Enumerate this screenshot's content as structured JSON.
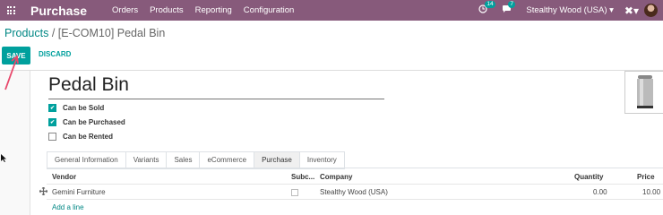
{
  "navbar": {
    "app_name": "Purchase",
    "menu": [
      "Orders",
      "Products",
      "Reporting",
      "Configuration"
    ],
    "activity_count": "14",
    "message_count": "7",
    "company": "Stealthy Wood (USA)",
    "bg_color": "#875a7b"
  },
  "breadcrumb": {
    "parent": "Products",
    "current": "[E-COM10] Pedal Bin"
  },
  "actions": {
    "save": "SAVE",
    "discard": "DISCARD"
  },
  "product": {
    "name": "Pedal Bin",
    "can_be_sold": {
      "label": "Can be Sold",
      "checked": true
    },
    "can_be_purchased": {
      "label": "Can be Purchased",
      "checked": true
    },
    "can_be_rented": {
      "label": "Can be Rented",
      "checked": false
    }
  },
  "tabs": [
    "General Information",
    "Variants",
    "Sales",
    "eCommerce",
    "Purchase",
    "Inventory"
  ],
  "active_tab": "Purchase",
  "vendor_table": {
    "headers": {
      "vendor": "Vendor",
      "subcontractor": "Subc...",
      "company": "Company",
      "quantity": "Quantity",
      "price": "Price"
    },
    "rows": [
      {
        "vendor": "Gemini Furniture",
        "company": "Stealthy Wood (USA)",
        "quantity": "0.00",
        "price": "10.00"
      }
    ],
    "add_line": "Add a line"
  },
  "accent_color": "#00a09d"
}
